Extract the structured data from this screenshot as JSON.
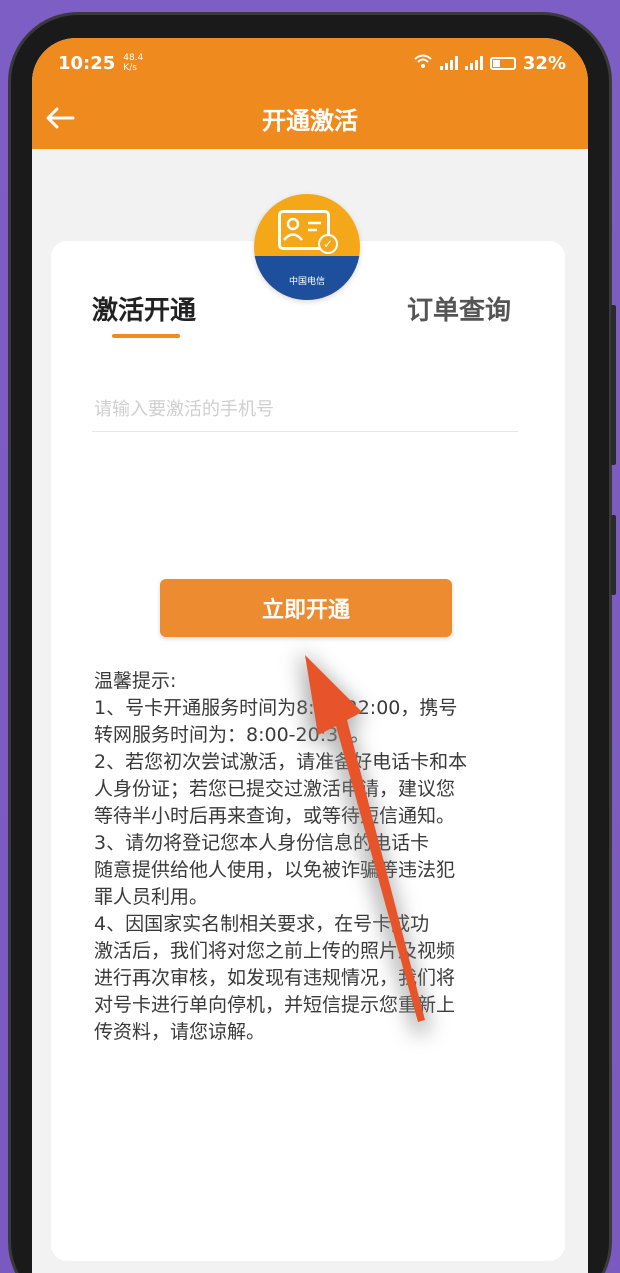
{
  "status_bar": {
    "time": "10:25",
    "net_speed_value": "48.4",
    "net_speed_unit": "K/s",
    "battery": "32%"
  },
  "nav": {
    "title": "开通激活"
  },
  "logo": {
    "brand_text": "中国电信"
  },
  "tabs": [
    {
      "label": "激活开通",
      "active": true
    },
    {
      "label": "订单查询",
      "active": false
    }
  ],
  "form": {
    "phone_placeholder": "请输入要激活的手机号",
    "phone_value": "",
    "submit_label": "立即开通"
  },
  "tips": {
    "title": "温馨提示:",
    "lines": [
      "1、号卡开通服务时间为8:00-22:00，携号",
      "转网服务时间为：8:00-20:30。",
      "2、若您初次尝试激活，请准备好电话卡和本",
      "人身份证；若您已提交过激活申请，建议您",
      "等待半小时后再来查询，或等待短信通知。",
      "3、请勿将登记您本人身份信息的电话卡",
      "随意提供给他人使用，以免被诈骗等违法犯",
      "罪人员利用。",
      "4、因国家实名制相关要求，在号卡成功",
      "激活后，我们将对您之前上传的照片及视频",
      "进行再次审核，如发现有违规情况，我们将",
      "对号卡进行单向停机，并短信提示您重新上",
      "传资料，请您谅解。"
    ]
  },
  "colors": {
    "header": "#ee8a1e",
    "button": "#ec8b2f",
    "tab_underline": "#ee8a1e",
    "arrow": "#e8542a",
    "background": "#7a5ac0"
  },
  "icons": {
    "back": "arrow-left-icon",
    "wifi": "wifi-icon",
    "signal": "signal-icon",
    "battery": "battery-icon"
  }
}
